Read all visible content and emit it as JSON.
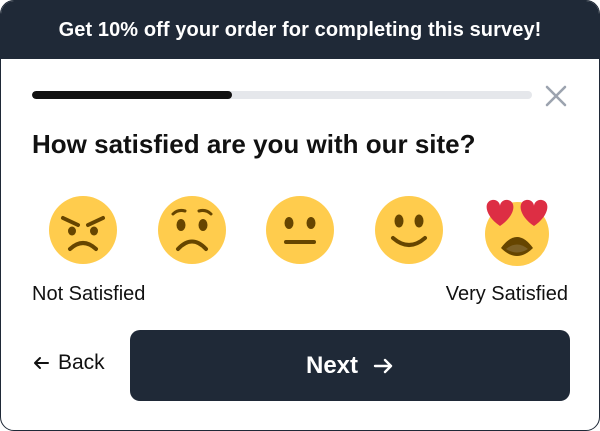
{
  "banner": {
    "text": "Get 10% off your order for completing this survey!"
  },
  "progress": {
    "percent": 40
  },
  "icons": {
    "close": "close-icon",
    "back": "arrow-left-icon",
    "next": "arrow-right-icon"
  },
  "question": {
    "text": "How satisfied are you with our site?"
  },
  "ratings": [
    {
      "name": "angry-face-icon"
    },
    {
      "name": "frowning-face-icon"
    },
    {
      "name": "neutral-face-icon"
    },
    {
      "name": "slightly-smiling-face-icon"
    },
    {
      "name": "heart-eyes-face-icon"
    }
  ],
  "scale": {
    "low_label": "Not Satisfied",
    "high_label": "Very Satisfied"
  },
  "nav": {
    "back_label": "Back",
    "next_label": "Next"
  },
  "colors": {
    "dark": "#1f2937",
    "emoji_yellow": "#ffcc4d",
    "heart_red": "#dd2e44",
    "track": "#e5e7eb"
  }
}
